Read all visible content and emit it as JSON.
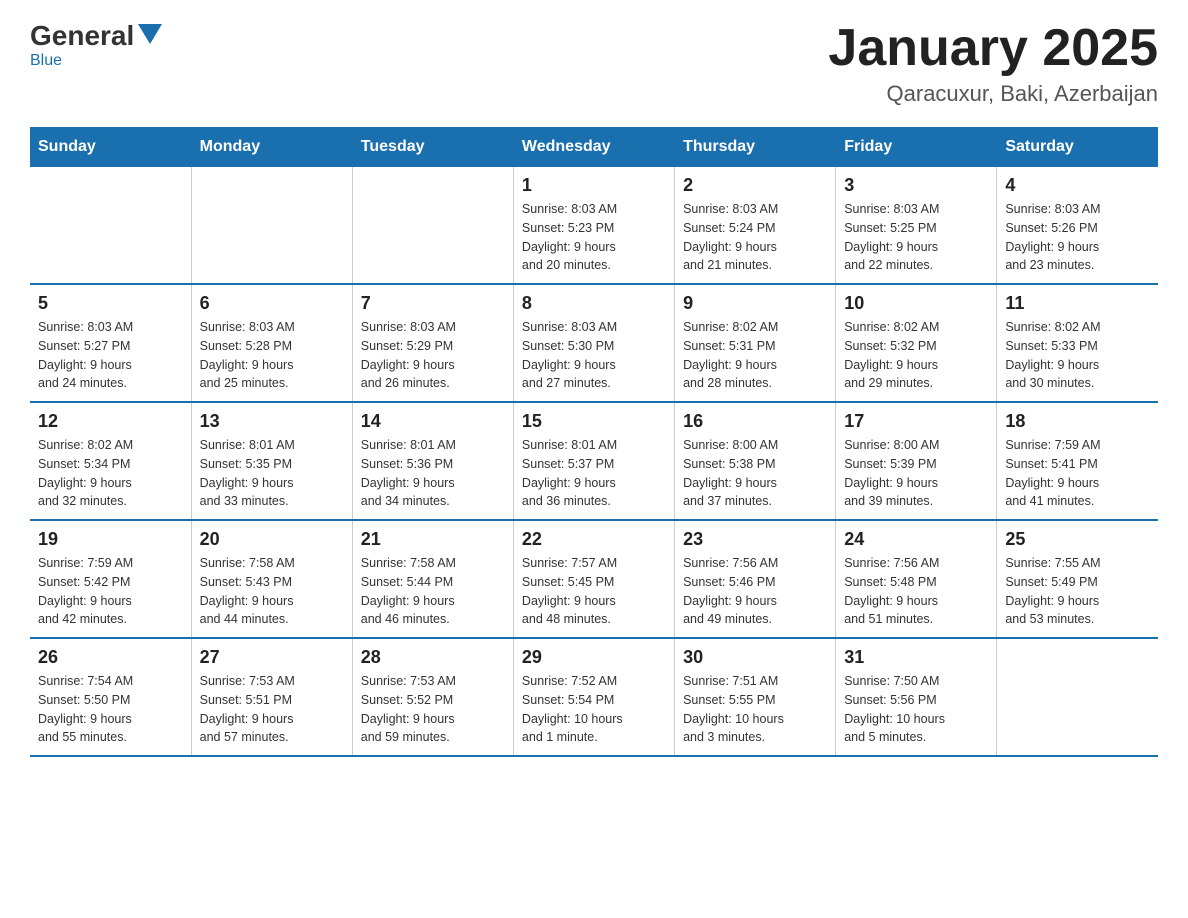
{
  "header": {
    "logo_general": "General",
    "logo_blue": "Blue",
    "month_title": "January 2025",
    "location": "Qaracuxur, Baki, Azerbaijan"
  },
  "days_of_week": [
    "Sunday",
    "Monday",
    "Tuesday",
    "Wednesday",
    "Thursday",
    "Friday",
    "Saturday"
  ],
  "weeks": [
    [
      {
        "day": "",
        "info": ""
      },
      {
        "day": "",
        "info": ""
      },
      {
        "day": "",
        "info": ""
      },
      {
        "day": "1",
        "info": "Sunrise: 8:03 AM\nSunset: 5:23 PM\nDaylight: 9 hours\nand 20 minutes."
      },
      {
        "day": "2",
        "info": "Sunrise: 8:03 AM\nSunset: 5:24 PM\nDaylight: 9 hours\nand 21 minutes."
      },
      {
        "day": "3",
        "info": "Sunrise: 8:03 AM\nSunset: 5:25 PM\nDaylight: 9 hours\nand 22 minutes."
      },
      {
        "day": "4",
        "info": "Sunrise: 8:03 AM\nSunset: 5:26 PM\nDaylight: 9 hours\nand 23 minutes."
      }
    ],
    [
      {
        "day": "5",
        "info": "Sunrise: 8:03 AM\nSunset: 5:27 PM\nDaylight: 9 hours\nand 24 minutes."
      },
      {
        "day": "6",
        "info": "Sunrise: 8:03 AM\nSunset: 5:28 PM\nDaylight: 9 hours\nand 25 minutes."
      },
      {
        "day": "7",
        "info": "Sunrise: 8:03 AM\nSunset: 5:29 PM\nDaylight: 9 hours\nand 26 minutes."
      },
      {
        "day": "8",
        "info": "Sunrise: 8:03 AM\nSunset: 5:30 PM\nDaylight: 9 hours\nand 27 minutes."
      },
      {
        "day": "9",
        "info": "Sunrise: 8:02 AM\nSunset: 5:31 PM\nDaylight: 9 hours\nand 28 minutes."
      },
      {
        "day": "10",
        "info": "Sunrise: 8:02 AM\nSunset: 5:32 PM\nDaylight: 9 hours\nand 29 minutes."
      },
      {
        "day": "11",
        "info": "Sunrise: 8:02 AM\nSunset: 5:33 PM\nDaylight: 9 hours\nand 30 minutes."
      }
    ],
    [
      {
        "day": "12",
        "info": "Sunrise: 8:02 AM\nSunset: 5:34 PM\nDaylight: 9 hours\nand 32 minutes."
      },
      {
        "day": "13",
        "info": "Sunrise: 8:01 AM\nSunset: 5:35 PM\nDaylight: 9 hours\nand 33 minutes."
      },
      {
        "day": "14",
        "info": "Sunrise: 8:01 AM\nSunset: 5:36 PM\nDaylight: 9 hours\nand 34 minutes."
      },
      {
        "day": "15",
        "info": "Sunrise: 8:01 AM\nSunset: 5:37 PM\nDaylight: 9 hours\nand 36 minutes."
      },
      {
        "day": "16",
        "info": "Sunrise: 8:00 AM\nSunset: 5:38 PM\nDaylight: 9 hours\nand 37 minutes."
      },
      {
        "day": "17",
        "info": "Sunrise: 8:00 AM\nSunset: 5:39 PM\nDaylight: 9 hours\nand 39 minutes."
      },
      {
        "day": "18",
        "info": "Sunrise: 7:59 AM\nSunset: 5:41 PM\nDaylight: 9 hours\nand 41 minutes."
      }
    ],
    [
      {
        "day": "19",
        "info": "Sunrise: 7:59 AM\nSunset: 5:42 PM\nDaylight: 9 hours\nand 42 minutes."
      },
      {
        "day": "20",
        "info": "Sunrise: 7:58 AM\nSunset: 5:43 PM\nDaylight: 9 hours\nand 44 minutes."
      },
      {
        "day": "21",
        "info": "Sunrise: 7:58 AM\nSunset: 5:44 PM\nDaylight: 9 hours\nand 46 minutes."
      },
      {
        "day": "22",
        "info": "Sunrise: 7:57 AM\nSunset: 5:45 PM\nDaylight: 9 hours\nand 48 minutes."
      },
      {
        "day": "23",
        "info": "Sunrise: 7:56 AM\nSunset: 5:46 PM\nDaylight: 9 hours\nand 49 minutes."
      },
      {
        "day": "24",
        "info": "Sunrise: 7:56 AM\nSunset: 5:48 PM\nDaylight: 9 hours\nand 51 minutes."
      },
      {
        "day": "25",
        "info": "Sunrise: 7:55 AM\nSunset: 5:49 PM\nDaylight: 9 hours\nand 53 minutes."
      }
    ],
    [
      {
        "day": "26",
        "info": "Sunrise: 7:54 AM\nSunset: 5:50 PM\nDaylight: 9 hours\nand 55 minutes."
      },
      {
        "day": "27",
        "info": "Sunrise: 7:53 AM\nSunset: 5:51 PM\nDaylight: 9 hours\nand 57 minutes."
      },
      {
        "day": "28",
        "info": "Sunrise: 7:53 AM\nSunset: 5:52 PM\nDaylight: 9 hours\nand 59 minutes."
      },
      {
        "day": "29",
        "info": "Sunrise: 7:52 AM\nSunset: 5:54 PM\nDaylight: 10 hours\nand 1 minute."
      },
      {
        "day": "30",
        "info": "Sunrise: 7:51 AM\nSunset: 5:55 PM\nDaylight: 10 hours\nand 3 minutes."
      },
      {
        "day": "31",
        "info": "Sunrise: 7:50 AM\nSunset: 5:56 PM\nDaylight: 10 hours\nand 5 minutes."
      },
      {
        "day": "",
        "info": ""
      }
    ]
  ]
}
